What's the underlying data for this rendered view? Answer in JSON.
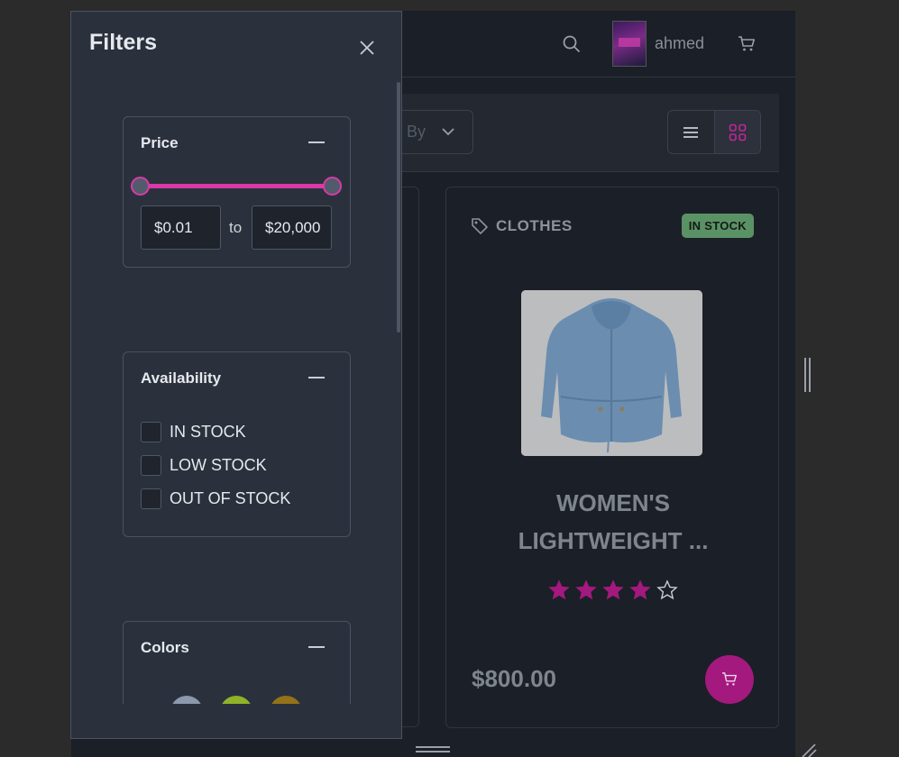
{
  "header": {
    "username": "ahmed"
  },
  "toolbar": {
    "sort_partial_text": "By"
  },
  "product": {
    "category": "CLOTHES",
    "stock_badge": "IN STOCK",
    "name_line1": "WOMEN'S",
    "name_line2": "LIGHTWEIGHT ...",
    "rating": 4,
    "rating_max": 5,
    "price": "$800.00"
  },
  "filters": {
    "title": "Filters",
    "price": {
      "title": "Price",
      "min_value": "$0.01",
      "to_label": "to",
      "max_value": "$20,000"
    },
    "availability": {
      "title": "Availability",
      "options": [
        "IN STOCK",
        "LOW STOCK",
        "OUT OF STOCK"
      ]
    },
    "colors": {
      "title": "Colors",
      "swatches": [
        "#8b98ad",
        "#8fb229",
        "#947219"
      ]
    }
  },
  "colors": {
    "accent": "#d83aa7",
    "cart_button": "#a3197e",
    "stock_badge_bg": "#5b9265",
    "star_filled": "#a3197e"
  }
}
